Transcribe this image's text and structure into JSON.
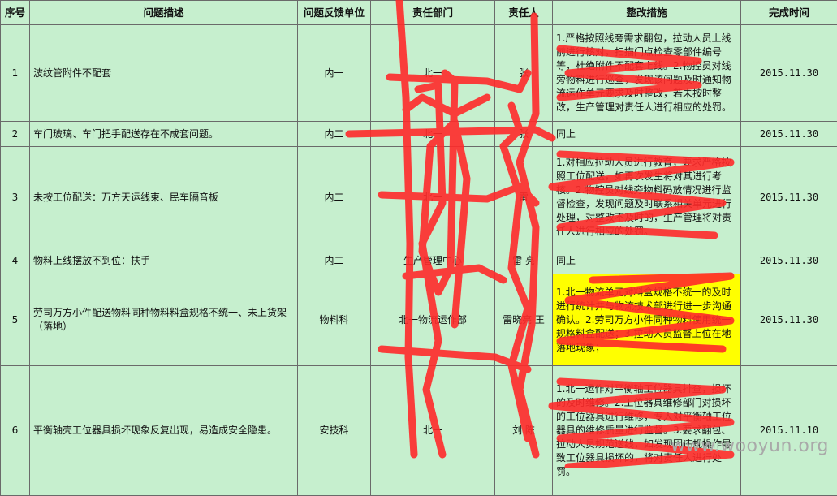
{
  "headers": {
    "seq": "序号",
    "problem": "问题描述",
    "feedback_unit": "问题反馈单位",
    "dept": "责任部门",
    "person": "责任人",
    "measures": "整改措施",
    "done_time": "完成时间"
  },
  "rows": [
    {
      "seq": "1",
      "problem": "波纹管附件不配套",
      "feedback_unit": "内一",
      "dept": "北一",
      "person": "张",
      "measures": "1.严格按照线旁需求翻包，拉动人员上线前进行核对，扫描门点检查零部件编号等，杜绝附件不配套上线。2.物控员对线旁物料进行巡查，发现该问题及时通知物流运作单元要求及时整改，若未按时整改，生产管理对责任人进行相应的处罚。",
      "done_time": "2015.11.30"
    },
    {
      "seq": "2",
      "problem": "车门玻璃、车门把手配送存在不成套问题。",
      "feedback_unit": "内二",
      "dept": "北一",
      "person": "张",
      "measures": "同上",
      "done_time": "2015.11.30"
    },
    {
      "seq": "3",
      "problem": "未按工位配送：万方天运线束、民车隔音板",
      "feedback_unit": "内二",
      "dept": "北一",
      "person": "雷",
      "measures": "1.对相应拉动人员进行教育，要求严格按照工位配送，如再次发生将对其进行考核。2.物控员对线旁物料码放情况进行监督检查，发现问题及时联系相关单元进行处理，对整改不及时的，生产管理将对责任人进行相应的处罚。",
      "done_time": "2015.11.30"
    },
    {
      "seq": "4",
      "problem": "物料上线摆放不到位：扶手",
      "feedback_unit": "内二",
      "dept": "生产管理中心",
      "person": "雷 亮",
      "measures": "同上",
      "done_time": "2015.11.30"
    },
    {
      "seq": "5",
      "problem": "劳司万方小件配送物料同种物料料盒规格不统一、未上货架（落地）",
      "feedback_unit": "物料科",
      "dept": "北一物流运作部",
      "person": "雷晓亮 王",
      "measures": "1.北一物流单元对料盒规格不统一的及时进行统计并与物流技术部进行进一步沟通确认。2.劳司万方小件同种物料使用统一规格料盒配送；3.拉动人员监督上位在地落地现象；",
      "done_time": "2015.11.30"
    },
    {
      "seq": "6",
      "problem": "平衡轴壳工位器具损坏现象反复出现，易造成安全隐患。",
      "feedback_unit": "安技科",
      "dept": "北一",
      "person": "刘 陈",
      "measures": "1.北一运作对平衡轴工位器具排查，损坏的及时维修。2.工位器具维修部门对损坏的工位器具进行维修，专人对平衡轴工位器具的维修质量进行监督。3.要求翻包、拉动人员规范送线，如发现因违规操作导致工位器具损坏的，将对责任人进行处罚。",
      "done_time": "2015.11.10"
    }
  ],
  "watermark": "www.wooyun.org",
  "colors": {
    "sheet_bg": "#c6efce",
    "highlight": "#ffff00",
    "scribble": "#ff2a2a",
    "grid": "#6a6a6a"
  }
}
